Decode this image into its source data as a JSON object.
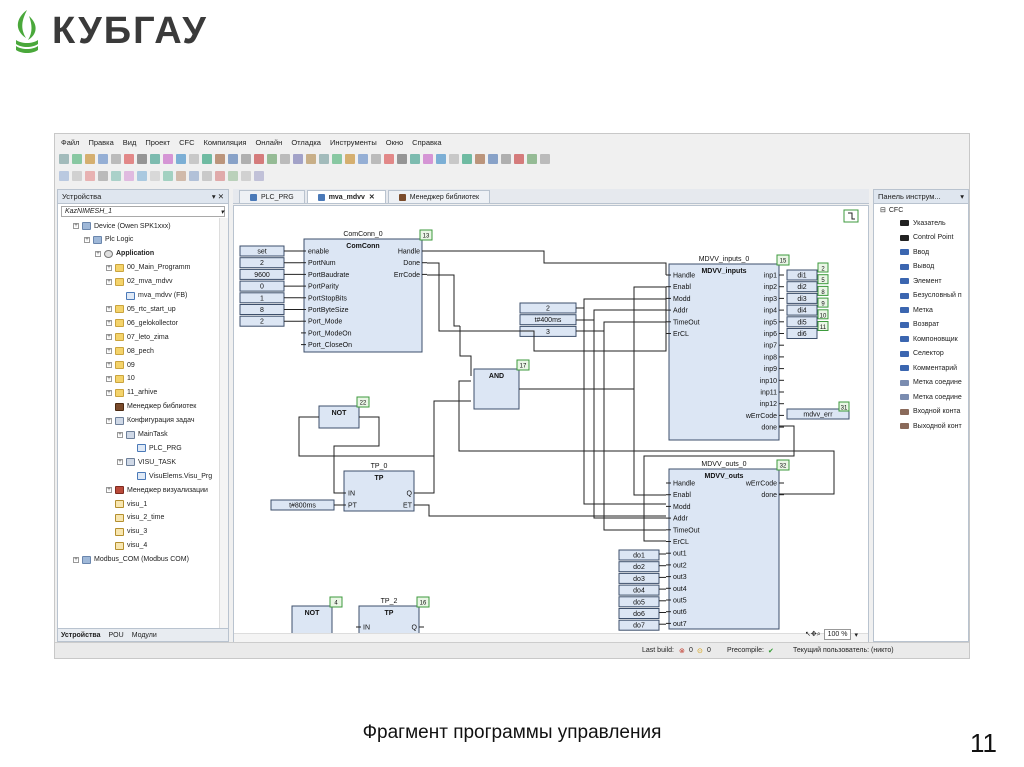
{
  "brand": {
    "name": "КУБГАУ",
    "color": "#4aa83b"
  },
  "slide": {
    "caption": "Фрагмент программы управления",
    "page": "11"
  },
  "menu": [
    "Файл",
    "Правка",
    "Вид",
    "Проект",
    "CFC",
    "Компиляция",
    "Онлайн",
    "Отладка",
    "Инструменты",
    "Окно",
    "Справка"
  ],
  "devices_panel": {
    "title": "Устройства",
    "combo": "KazNIMESH_1",
    "tree": [
      {
        "label": "Device (Owen SPK1xxx)",
        "icon": "dev",
        "level": 1
      },
      {
        "label": "Plc Logic",
        "icon": "dev",
        "level": 2
      },
      {
        "label": "Application",
        "icon": "app",
        "level": 3,
        "bold": true
      },
      {
        "label": "00_Main_Programm",
        "icon": "folder",
        "level": 4
      },
      {
        "label": "02_mva_mdvv",
        "icon": "folder",
        "level": 4
      },
      {
        "label": "mva_mdvv (FB)",
        "icon": "prg",
        "level": 5
      },
      {
        "label": "05_rtc_start_up",
        "icon": "folder",
        "level": 4
      },
      {
        "label": "06_gelokollector",
        "icon": "folder",
        "level": 4
      },
      {
        "label": "07_leto_zima",
        "icon": "folder",
        "level": 4
      },
      {
        "label": "08_pech",
        "icon": "folder",
        "level": 4
      },
      {
        "label": "09",
        "icon": "folder",
        "level": 4
      },
      {
        "label": "10",
        "icon": "folder",
        "level": 4
      },
      {
        "label": "11_arhive",
        "icon": "folder",
        "level": 4
      },
      {
        "label": "Менеджер библиотек",
        "icon": "lib",
        "level": 4
      },
      {
        "label": "Конфигурация задач",
        "icon": "task",
        "level": 4
      },
      {
        "label": "MainTask",
        "icon": "task",
        "level": 5
      },
      {
        "label": "PLC_PRG",
        "icon": "prg",
        "level": 6
      },
      {
        "label": "VISU_TASK",
        "icon": "task",
        "level": 5
      },
      {
        "label": "VisuElems.Visu_Prg",
        "icon": "prg",
        "level": 6
      },
      {
        "label": "Менеджер визуализации",
        "icon": "vis",
        "level": 4
      },
      {
        "label": "visu_1",
        "icon": "doc",
        "level": 4
      },
      {
        "label": "visu_2_time",
        "icon": "doc",
        "level": 4
      },
      {
        "label": "visu_3",
        "icon": "doc",
        "level": 4
      },
      {
        "label": "visu_4",
        "icon": "doc",
        "level": 4
      },
      {
        "label": "Modbus_COM (Modbus COM)",
        "icon": "dev",
        "level": 1
      }
    ],
    "bottom_tabs": [
      "Устройства",
      "POU",
      "Модули"
    ]
  },
  "editor_tabs": [
    {
      "label": "PLC_PRG",
      "active": false
    },
    {
      "label": "mva_mdvv",
      "active": true
    },
    {
      "label": "Менеджер библиотек",
      "active": false
    }
  ],
  "diagram": {
    "blocks": [
      {
        "id": "comconn",
        "instance": "ComConn_0",
        "type": "ComConn",
        "order": "13",
        "inputs": [
          "enable",
          "PortNum",
          "PortBaudrate",
          "PortParity",
          "PortStopBits",
          "PortByteSize",
          "Port_Mode",
          "Port_ModeOn",
          "Port_CloseOn"
        ],
        "outputs": [
          "Handle",
          "Done",
          "ErrCode"
        ]
      },
      {
        "id": "mdvv_in",
        "instance": "MDVV_inputs_0",
        "type": "MDVV_inputs",
        "order": "15",
        "inputs": [
          "Handle",
          "Enabl",
          "Modd",
          "Addr",
          "TimeOut",
          "ErCL"
        ],
        "outputs": [
          "inp1",
          "inp2",
          "inp3",
          "inp4",
          "inp5",
          "inp6",
          "inp7",
          "inp8",
          "inp9",
          "inp10",
          "inp11",
          "inp12",
          "wErrCode",
          "done"
        ]
      },
      {
        "id": "mdvv_out",
        "instance": "MDVV_outs_0",
        "type": "MDVV_outs",
        "order": "32",
        "inputs": [
          "Handle",
          "Enabl",
          "Modd",
          "Addr",
          "TimeOut",
          "ErCL",
          "out1",
          "out2",
          "out3",
          "out4",
          "out5",
          "out6",
          "out7"
        ],
        "outputs": [
          "wErrCode",
          "done"
        ]
      },
      {
        "id": "and",
        "type": "AND",
        "order": "17"
      },
      {
        "id": "not1",
        "type": "NOT",
        "order": "22"
      },
      {
        "id": "tp0",
        "instance": "TP_0",
        "type": "TP",
        "order": "",
        "inputs": [
          "IN",
          "PT"
        ],
        "outputs": [
          "Q",
          "ET"
        ]
      },
      {
        "id": "not2",
        "type": "NOT",
        "order": "4"
      },
      {
        "id": "tp2",
        "instance": "TP_2",
        "type": "TP",
        "order": "16",
        "inputs": [
          "IN"
        ],
        "outputs": [
          "Q"
        ]
      }
    ],
    "comconn_consts": [
      "set",
      "2",
      "9600",
      "0",
      "1",
      "8",
      "2"
    ],
    "mdvv_consts": [
      "2",
      "t#400ms",
      "3"
    ],
    "tp_const": "t#800ms",
    "di_outputs": [
      {
        "label": "di1",
        "order": "2"
      },
      {
        "label": "di2",
        "order": "5"
      },
      {
        "label": "di3",
        "order": "8"
      },
      {
        "label": "di4",
        "order": "9"
      },
      {
        "label": "di5",
        "order": "10"
      },
      {
        "label": "di6",
        "order": "11"
      }
    ],
    "err_output": {
      "label": "mdvv_err",
      "order": "31"
    },
    "do_inputs": [
      "do1",
      "do2",
      "do3",
      "do4",
      "do5",
      "do6",
      "do7"
    ]
  },
  "zoom": "100 %",
  "toolbox": {
    "title": "Панель инструм...",
    "category": "CFC",
    "items": [
      "Указатель",
      "Control Point",
      "Ввод",
      "Вывод",
      "Элемент",
      "Безусловный п",
      "Метка",
      "Возврат",
      "Компоновщик",
      "Селектор",
      "Комментарий",
      "Метка соедине",
      "Метка соедине",
      "Входной конта",
      "Выходной конт"
    ]
  },
  "status": {
    "last_build_label": "Last build:",
    "errors": "0",
    "warnings": "0",
    "precompile_label": "Precompile:",
    "user": "Текущий пользователь: (никто)"
  }
}
